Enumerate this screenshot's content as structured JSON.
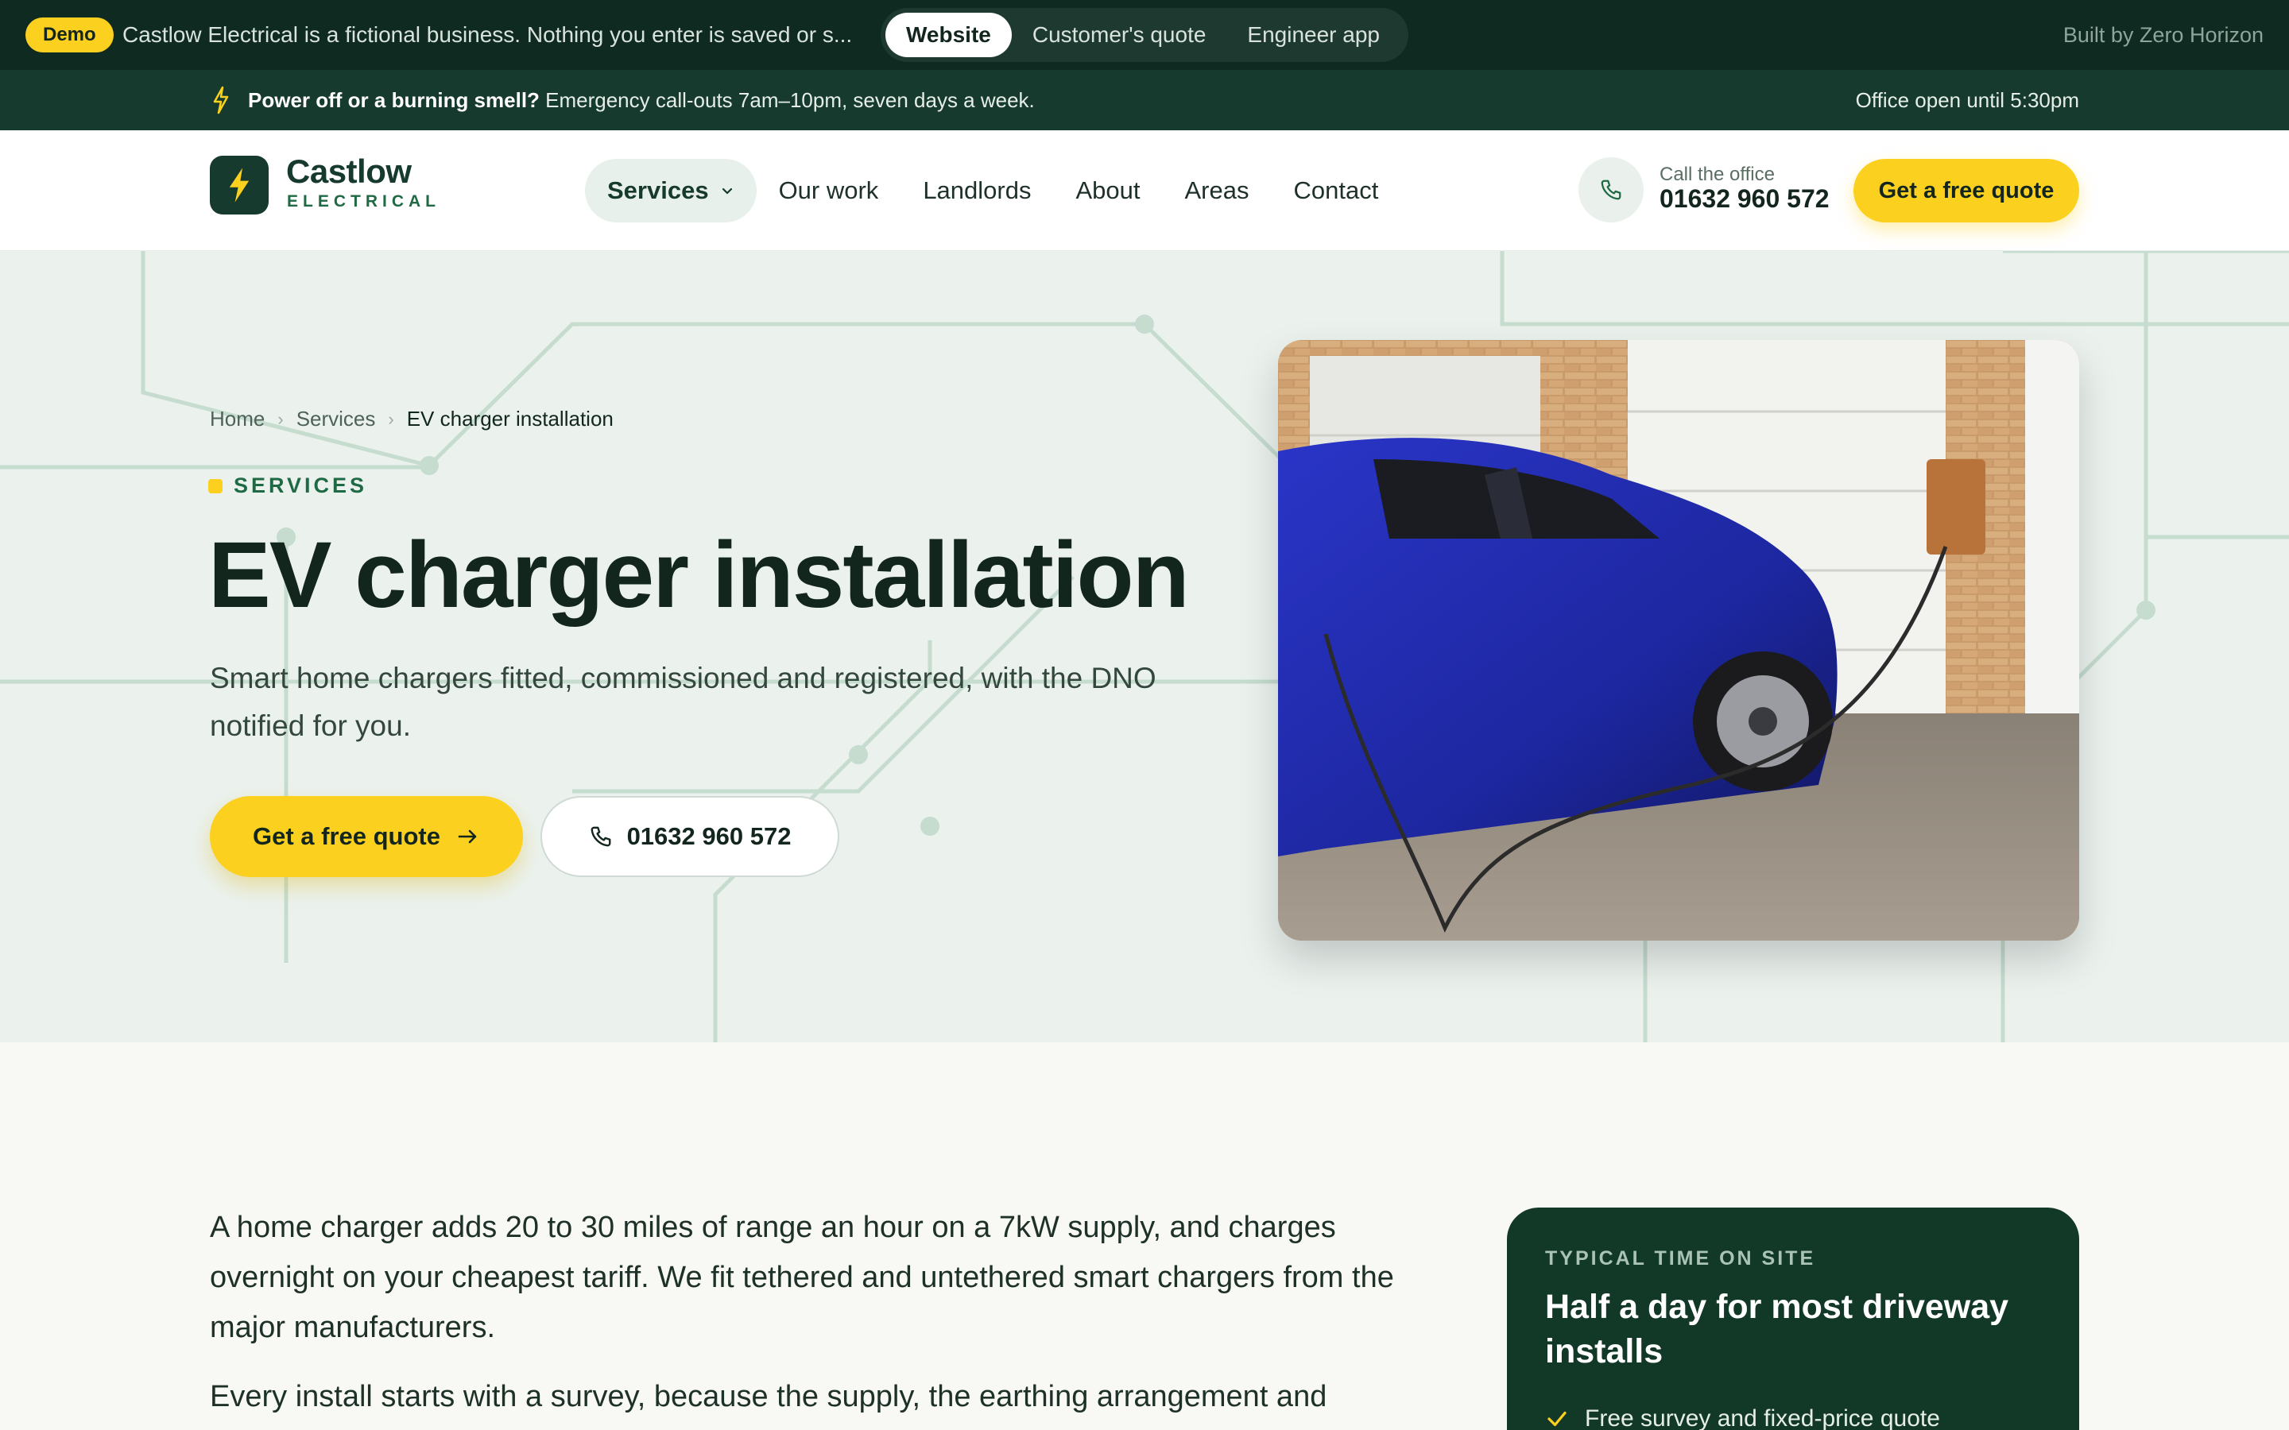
{
  "demobar": {
    "badge": "Demo",
    "text": "Castlow Electrical is a fictional business. Nothing you enter is saved or s...",
    "views": [
      "Website",
      "Customer's quote",
      "Engineer app"
    ],
    "active_view": "Website",
    "built_by": "Built by Zero Horizon"
  },
  "emergency": {
    "bold": "Power off or a burning smell?",
    "text": " Emergency call-outs 7am–10pm, seven days a week.",
    "office": "Office open until 5:30pm"
  },
  "header": {
    "logo_name": "Castlow",
    "logo_sub": "ELECTRICAL",
    "nav": [
      "Services",
      "Our work",
      "Landlords",
      "About",
      "Areas",
      "Contact"
    ],
    "call_label": "Call the office",
    "call_number": "01632 960 572",
    "cta": "Get a free quote"
  },
  "hero": {
    "breadcrumb": [
      "Home",
      "Services",
      "EV charger installation"
    ],
    "eyebrow": "SERVICES",
    "title": "EV charger installation",
    "lede": "Smart home chargers fitted, commissioned and registered, with the DNO notified for you.",
    "primary_button": "Get a free quote",
    "phone_button": "01632 960 572"
  },
  "content": {
    "paragraphs": [
      "A home charger adds 20 to 30 miles of range an hour on a 7kW supply, and charges overnight on your cheapest tariff. We fit tethered and untethered smart chargers from the major manufacturers.",
      "Every install starts with a survey, because the supply, the earthing arrangement and"
    ]
  },
  "card": {
    "kicker": "TYPICAL TIME ON SITE",
    "title": "Half a day for most driveway installs",
    "item": "Free survey and fixed-price quote"
  },
  "colors": {
    "brand_dark": "#163a2d",
    "accent_yellow": "#fcd01e",
    "brand_green": "#1f6a45"
  }
}
